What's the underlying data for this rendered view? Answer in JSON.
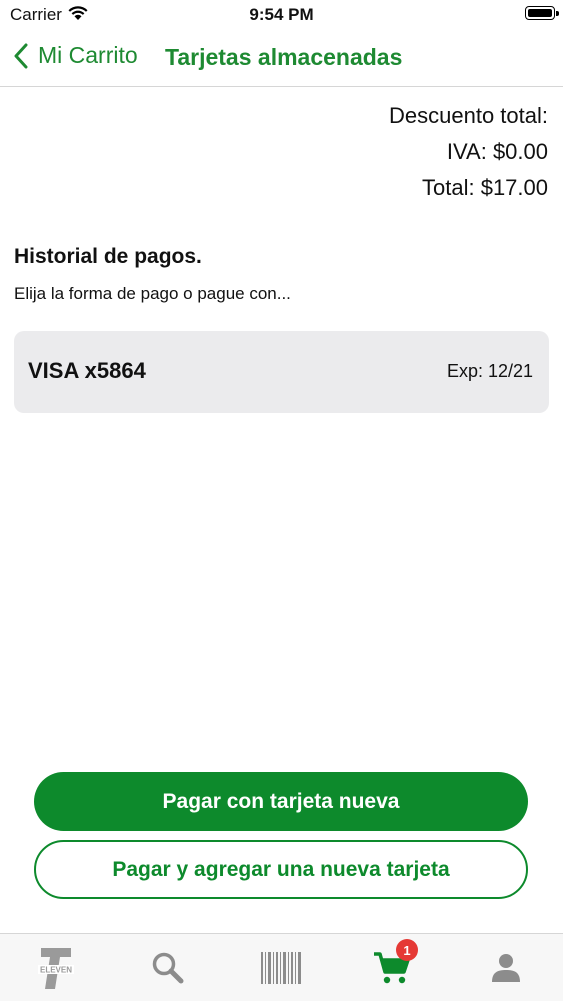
{
  "status_bar": {
    "carrier": "Carrier",
    "time": "9:54 PM"
  },
  "nav": {
    "back_label": "Mi Carrito",
    "title": "Tarjetas almacenadas"
  },
  "totals": {
    "discount": "Descuento total:",
    "iva": "IVA: $0.00",
    "total": "Total: $17.00"
  },
  "history": {
    "title": "Historial de pagos.",
    "subtitle": "Elija la forma de pago o pague con...",
    "cards": [
      {
        "name": "VISA x5864",
        "exp": "Exp: 12/21"
      }
    ]
  },
  "buttons": {
    "pay_new": "Pagar con tarjeta nueva",
    "pay_add": "Pagar y agregar una nueva tarjeta"
  },
  "tabbar": {
    "items": [
      {
        "icon": "seven-eleven-logo-icon"
      },
      {
        "icon": "search-icon"
      },
      {
        "icon": "barcode-icon"
      },
      {
        "icon": "cart-icon",
        "badge": "1",
        "active": true
      },
      {
        "icon": "profile-icon"
      }
    ],
    "accent": "#0d8a2c",
    "badge_color": "#e53935"
  }
}
